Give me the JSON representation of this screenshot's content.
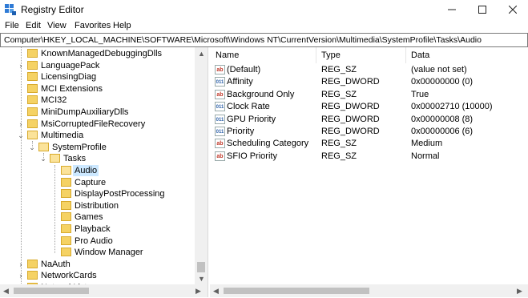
{
  "window": {
    "title": "Registry Editor"
  },
  "menu": [
    "File",
    "Edit",
    "View",
    "Favorites",
    "Help"
  ],
  "address": "Computer\\HKEY_LOCAL_MACHINE\\SOFTWARE\\Microsoft\\Windows NT\\CurrentVersion\\Multimedia\\SystemProfile\\Tasks\\Audio",
  "tree": {
    "items": [
      {
        "label": "KnownManagedDebuggingDlls",
        "level": 1,
        "expander": "none"
      },
      {
        "label": "LanguagePack",
        "level": 1,
        "expander": "collapsed"
      },
      {
        "label": "LicensingDiag",
        "level": 1,
        "expander": "none"
      },
      {
        "label": "MCI Extensions",
        "level": 1,
        "expander": "none"
      },
      {
        "label": "MCI32",
        "level": 1,
        "expander": "none"
      },
      {
        "label": "MiniDumpAuxiliaryDlls",
        "level": 1,
        "expander": "none"
      },
      {
        "label": "MsiCorruptedFileRecovery",
        "level": 1,
        "expander": "collapsed"
      },
      {
        "label": "Multimedia",
        "level": 1,
        "expander": "expanded"
      },
      {
        "label": "SystemProfile",
        "level": 2,
        "expander": "expanded"
      },
      {
        "label": "Tasks",
        "level": 3,
        "expander": "expanded"
      },
      {
        "label": "Audio",
        "level": 4,
        "expander": "none",
        "selected": true
      },
      {
        "label": "Capture",
        "level": 4,
        "expander": "none"
      },
      {
        "label": "DisplayPostProcessing",
        "level": 4,
        "expander": "none"
      },
      {
        "label": "Distribution",
        "level": 4,
        "expander": "none"
      },
      {
        "label": "Games",
        "level": 4,
        "expander": "none"
      },
      {
        "label": "Playback",
        "level": 4,
        "expander": "none"
      },
      {
        "label": "Pro Audio",
        "level": 4,
        "expander": "none"
      },
      {
        "label": "Window Manager",
        "level": 4,
        "expander": "none"
      },
      {
        "label": "NaAuth",
        "level": 1,
        "expander": "collapsed"
      },
      {
        "label": "NetworkCards",
        "level": 1,
        "expander": "collapsed"
      },
      {
        "label": "NetworkList",
        "level": 1,
        "expander": "collapsed"
      }
    ]
  },
  "list": {
    "columns": [
      "Name",
      "Type",
      "Data"
    ],
    "rows": [
      {
        "icon": "string-value-icon",
        "name": "(Default)",
        "type": "REG_SZ",
        "data": "(value not set)"
      },
      {
        "icon": "binary-value-icon",
        "name": "Affinity",
        "type": "REG_DWORD",
        "data": "0x00000000 (0)"
      },
      {
        "icon": "string-value-icon",
        "name": "Background Only",
        "type": "REG_SZ",
        "data": "True"
      },
      {
        "icon": "binary-value-icon",
        "name": "Clock Rate",
        "type": "REG_DWORD",
        "data": "0x00002710 (10000)"
      },
      {
        "icon": "binary-value-icon",
        "name": "GPU Priority",
        "type": "REG_DWORD",
        "data": "0x00000008 (8)"
      },
      {
        "icon": "binary-value-icon",
        "name": "Priority",
        "type": "REG_DWORD",
        "data": "0x00000006 (6)"
      },
      {
        "icon": "string-value-icon",
        "name": "Scheduling Category",
        "type": "REG_SZ",
        "data": "Medium"
      },
      {
        "icon": "string-value-icon",
        "name": "SFIO Priority",
        "type": "REG_SZ",
        "data": "Normal"
      }
    ]
  },
  "colors": {
    "selection": "#cce8ff",
    "folder": "#f5d264",
    "scrollbar": "#f0f0f0"
  }
}
